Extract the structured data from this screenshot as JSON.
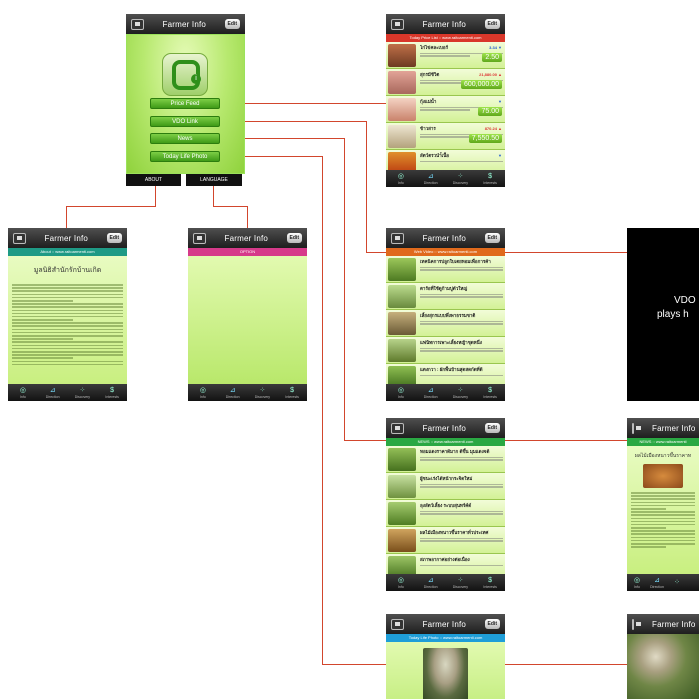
{
  "app_title": "Farmer Info",
  "edit_label": "Edit",
  "home": {
    "menu": [
      "Price Feed",
      "VDO Link",
      "News",
      "Today Life Photo"
    ],
    "about": "ABOUT",
    "language": "LANGUAGE"
  },
  "tabs": [
    {
      "icon": "globe-icon",
      "label": "Info"
    },
    {
      "icon": "chart-icon",
      "label": "Direction"
    },
    {
      "icon": "network-icon",
      "label": "Discovery"
    },
    {
      "icon": "dollar-icon",
      "label": "Interests"
    }
  ],
  "about_screen": {
    "strip": "About :: www.raitoarmenti.com",
    "heading": "มูลนิธิสำนักรักบ้านเกิด"
  },
  "option_screen": {
    "strip": "OPTION"
  },
  "price_screen": {
    "strip": "Today Price List :: www.raitoarmenti.com",
    "items": [
      {
        "title": "ไก่ไข่คละเบอร์",
        "delta": "3.34 ▼",
        "price": "2.50",
        "unit": "บาท/ฟอง"
      },
      {
        "title": "สุกรมีชีวิต",
        "delta": "21,880.00 ▲",
        "price": "600,000.00",
        "unit": "บาท/ตัน"
      },
      {
        "title": "กุ้งแม่น้ำ",
        "delta": "▼",
        "price": "75.00",
        "unit": "บาท/กิโล"
      },
      {
        "title": "ข้าวสาร",
        "delta": "870.24 ▲",
        "price": "7,550.50",
        "unit": "บาท/ตัน"
      },
      {
        "title": "สัตว์ตรวนำ้เนื้อ",
        "delta": "▼",
        "price": "",
        "unit": ""
      }
    ]
  },
  "vdo_screen": {
    "strip": "Web Video :: www.raitoarmenti.com",
    "items": [
      "เทคนิคการปลูกใบเตยหอมเพื่อการค้า",
      "ตาร้อที่ใช้ดูก้ามปูตัวใหญ่",
      "เลี้ยงสุกรแบบพึ่งพาธรรมชาติ",
      "แฟนิทการเพาะเลี้ยงหญ้าชุดหนึ่ง",
      "แตงกวา : ผักพื้นบ้านสุดสดกัดที่ดี"
    ]
  },
  "video_box": {
    "line1": "VDO",
    "line2": "plays h"
  },
  "news_screen": {
    "strip": "NEWS :: www.raitoarmenti.com",
    "items": [
      "หอมแดงราคาดีมาก ดีขึ้น มุมแดงจดี",
      "ผู้ชนะเร่งได้หน้ากระจิดใหม่",
      "ลุงสัตว์เลี้ยง ระบบสุนทร์ค์ด์",
      "ผลไม้เมืองหนาวขึ้นราคาทั่วประเทศ",
      "สภาพอากาศอย่างต่อเนื่อง"
    ]
  },
  "news_detail": {
    "strip": "NEWS :: www.raitoarmenti",
    "heading": "ผลไม้เมืองหนาวขึ้นราคาท"
  },
  "photo_screen": {
    "strip": "Today Life Photo :: www.raitoarmenti.com"
  }
}
